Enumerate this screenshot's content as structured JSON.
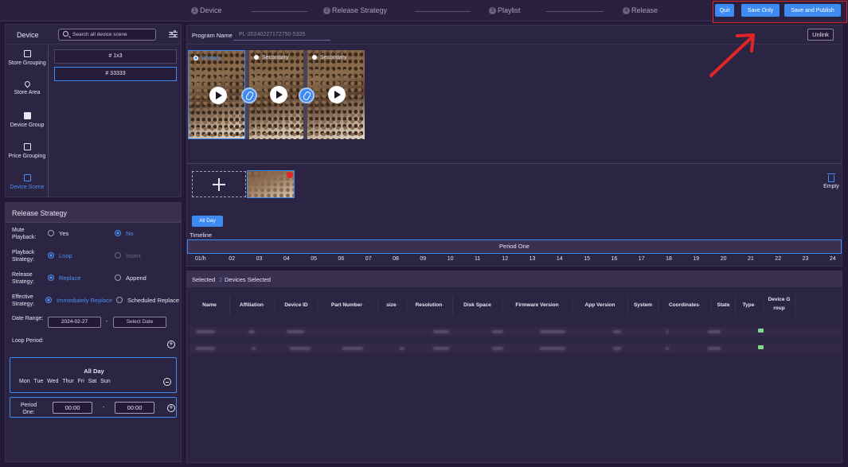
{
  "steps": [
    {
      "num": "1",
      "label": "Device"
    },
    {
      "num": "2",
      "label": "Release Strategy"
    },
    {
      "num": "3",
      "label": "Playlist"
    },
    {
      "num": "4",
      "label": "Release"
    }
  ],
  "actions": {
    "quit": "Quit",
    "save_only": "Save Only",
    "save_publish": "Save and Publish"
  },
  "device_panel": {
    "title": "Device",
    "search_placeholder": "Search all device scene",
    "nav": [
      {
        "label": "Store Grouping",
        "icon": "store-grouping-icon"
      },
      {
        "label": "Store Area",
        "icon": "location-pin-icon"
      },
      {
        "label": "Device Group",
        "icon": "device-group-icon"
      },
      {
        "label": "Price Grouping",
        "icon": "price-tag-icon"
      },
      {
        "label": "Device Scene",
        "icon": "device-scene-icon",
        "active": true
      }
    ],
    "scenes": [
      "# 1x3",
      "# 33333"
    ]
  },
  "release_strategy": {
    "title": "Release Strategy",
    "mute_label": "Mute Playback:",
    "mute_yes": "Yes",
    "mute_no": "No",
    "playback_label": "Playback Strategy:",
    "playback_loop": "Loop",
    "playback_insert": "Insert",
    "release_label": "Release Strategy:",
    "release_replace": "Replace",
    "release_append": "Append",
    "effective_label": "Effective Strategy:",
    "effective_immediate": "Immediately Replace",
    "effective_scheduled": "Scheduled Replace",
    "date_label": "Date Range:",
    "date_start": "2024-02-27",
    "date_sep": "-",
    "date_end_placeholder": "Select Date",
    "loop_label": "Loop Period:",
    "allday_title": "All Day",
    "weekdays": "Mon Tue Wed Thur Fri Sat Sun",
    "period_label": "Period One:",
    "period_start": "00:00",
    "period_sep": "-",
    "period_end": "00:00"
  },
  "program": {
    "name_label": "Program Name",
    "name_value": "PL-20240227172750-5325",
    "unlink": "Unlink",
    "screens": [
      {
        "label": "Primary",
        "selected": true
      },
      {
        "label": "Secondary",
        "selected": false
      },
      {
        "label": "Secondary",
        "selected": false
      }
    ],
    "empty_label": "Empty",
    "allday_tab": "All Day",
    "timeline_label": "Timeline",
    "period_name": "Period One",
    "hours": [
      "01/h",
      "02",
      "03",
      "04",
      "05",
      "06",
      "07",
      "08",
      "09",
      "10",
      "11",
      "12",
      "13",
      "14",
      "15",
      "16",
      "17",
      "18",
      "19",
      "20",
      "21",
      "22",
      "23",
      "24"
    ]
  },
  "devices": {
    "selected_prefix": "Selected",
    "selected_count": "2",
    "selected_suffix": "Devices Selected",
    "columns": [
      {
        "label": "Name",
        "sort": ""
      },
      {
        "label": "Affiliation",
        "sort": "-"
      },
      {
        "label": "Device ID",
        "sort": ""
      },
      {
        "label": "Part Number",
        "sort": "-"
      },
      {
        "label": "size",
        "sort": "-"
      },
      {
        "label": "Resolution",
        "sort": "-"
      },
      {
        "label": "Disk Space",
        "sort": ""
      },
      {
        "label": "Firmware Version",
        "sort": ""
      },
      {
        "label": "App Version",
        "sort": ""
      },
      {
        "label": "System",
        "sort": ""
      },
      {
        "label": "Coordinates",
        "sort": "-"
      },
      {
        "label": "State",
        "sort": ""
      },
      {
        "label": "Type",
        "sort": "-"
      },
      {
        "label": "Device G roup",
        "sort": ""
      }
    ],
    "state_color": "#7ed98a"
  },
  "colors": {
    "accent": "#3d8bf2",
    "background": "#231a38",
    "panel": "#2c2443",
    "annotation": "#e02525"
  }
}
